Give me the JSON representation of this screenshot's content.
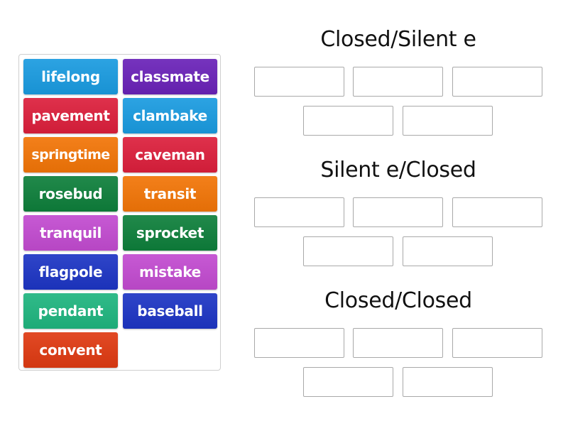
{
  "tiles": [
    {
      "label": "lifelong",
      "color": "#1a9be0"
    },
    {
      "label": "classmate",
      "color": "#6a22b8"
    },
    {
      "label": "pavement",
      "color": "#dc1f3c"
    },
    {
      "label": "clambake",
      "color": "#1a9be0"
    },
    {
      "label": "springtime",
      "color": "#f27507"
    },
    {
      "label": "caveman",
      "color": "#dc1f3c"
    },
    {
      "label": "rosebud",
      "color": "#0e7f3b"
    },
    {
      "label": "transit",
      "color": "#f27507"
    },
    {
      "label": "tranquil",
      "color": "#c24bd0"
    },
    {
      "label": "sprocket",
      "color": "#0e7f3b"
    },
    {
      "label": "flagpole",
      "color": "#1d35c4"
    },
    {
      "label": "mistake",
      "color": "#c24bd0"
    },
    {
      "label": "pendant",
      "color": "#1fb57f"
    },
    {
      "label": "baseball",
      "color": "#1d35c4"
    },
    {
      "label": "convent",
      "color": "#df3a12"
    }
  ],
  "groups": [
    {
      "title": "Closed/Silent e",
      "slots": 5
    },
    {
      "title": "Silent e/Closed",
      "slots": 5
    },
    {
      "title": "Closed/Closed",
      "slots": 5
    }
  ]
}
